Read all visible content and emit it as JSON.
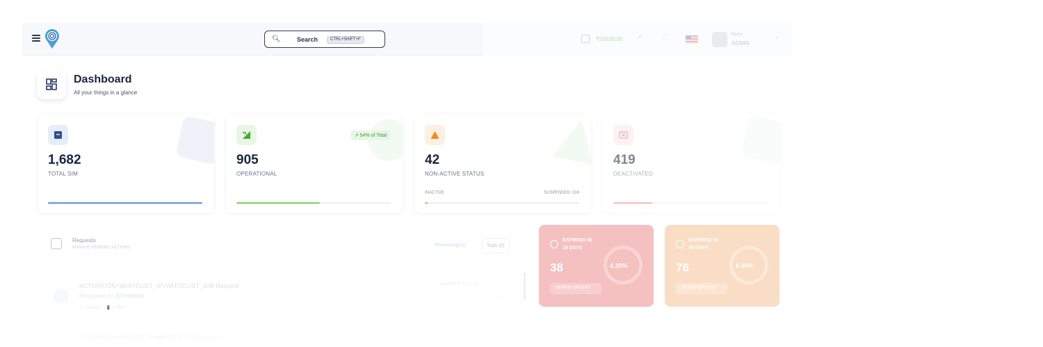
{
  "header": {
    "search_label": "Search",
    "search_shortcut": "CTRL+SHIFT+F",
    "balance": "₹20638.00",
    "user_name": "Demo",
    "user_role": "ADMIN"
  },
  "page": {
    "title": "Dashboard",
    "subtitle": "All your things in a glance"
  },
  "stats": {
    "total": {
      "value": "1,682",
      "label": "TOTAL SIM",
      "progress": 1.0,
      "color": "#8aaedb"
    },
    "operational": {
      "value": "905",
      "label": "OPERATIONAL",
      "badge": "54% of Total",
      "progress": 0.54,
      "color": "#9ddc87"
    },
    "nonactive": {
      "value": "42",
      "label": "NON-ACTIVE STATUS",
      "inactive_label": "INACTIVE",
      "suspended_label": "SUSPENDED: 316",
      "progress": 0.02,
      "color": "#f6b38a"
    },
    "deactivated": {
      "value": "419",
      "label": "DEACTIVATED",
      "progress": 0.25,
      "color": "#f2a5a9"
    }
  },
  "requests": {
    "title": "Requests",
    "subtitle": "MANAGE PENDING ACTIONS",
    "tab_processing": "Processing (1)",
    "tab_todo": "Todo (0)",
    "row_title": "ACTIVATION+WHITELIST_IP+WHITELIST_SIM Request",
    "row_by_prefix": "Requested by",
    "row_by_name": "JO Infotech",
    "row_meta": "ID: 3563277 · 📱 1 SIMs",
    "row_date": "26/09/2025 11:11 AM",
    "row2_title": "ACTIVATION+WHITELIST_IP+WHITELIST_SIM Request"
  },
  "expiring": [
    {
      "caption_line1": "EXPIRING IN",
      "caption_line2": "15 DAYS",
      "count": "38",
      "percent": "4.20%",
      "button": "RENEW ORDERS",
      "color": "#ee8d8d"
    },
    {
      "caption_line1": "EXPIRING IN",
      "caption_line2": "30 DAYS",
      "count": "76",
      "percent": "8.40%",
      "button": "RENEW ORDERS",
      "color": "#f6c397"
    }
  ]
}
